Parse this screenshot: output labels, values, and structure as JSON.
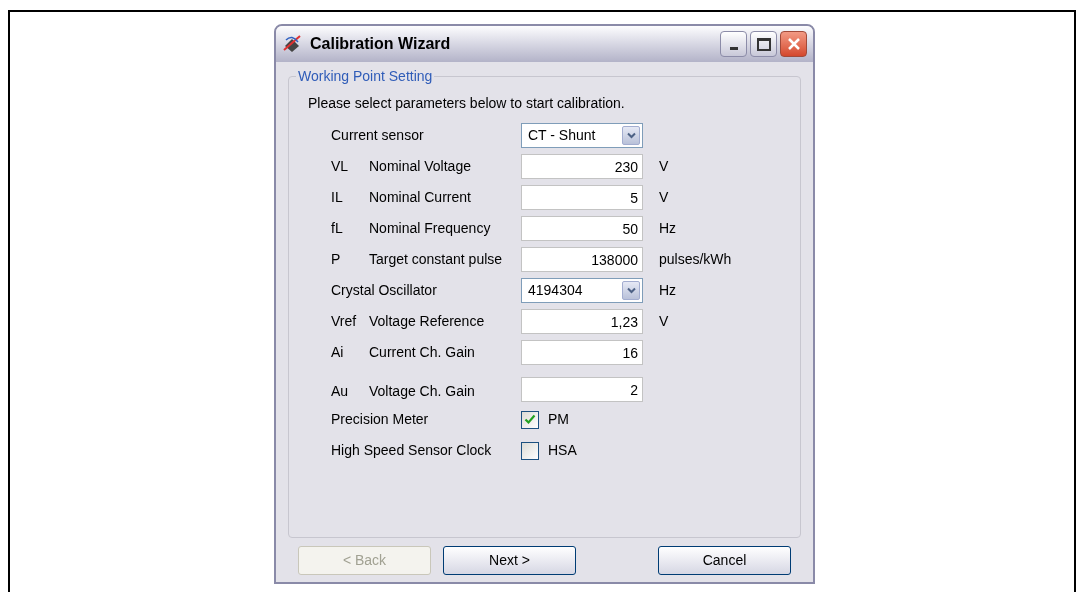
{
  "window": {
    "title": "Calibration Wizard"
  },
  "group": {
    "title": "Working Point Setting",
    "intro": "Please select parameters below to start calibration."
  },
  "rows": [
    {
      "kind": "dropdown",
      "symbol": "",
      "label": "Current sensor",
      "value": "CT - Shunt",
      "unit": ""
    },
    {
      "kind": "text",
      "symbol": "VL",
      "label": "Nominal Voltage",
      "value": "230",
      "unit": "V"
    },
    {
      "kind": "text",
      "symbol": "IL",
      "label": "Nominal Current",
      "value": "5",
      "unit": "V"
    },
    {
      "kind": "text",
      "symbol": "fL",
      "label": "Nominal Frequency",
      "value": "50",
      "unit": "Hz"
    },
    {
      "kind": "text",
      "symbol": "P",
      "label": "Target constant pulse",
      "value": "138000",
      "unit": "pulses/kWh"
    },
    {
      "kind": "dropdown",
      "symbol": "",
      "label": "Crystal Oscillator",
      "value": "4194304",
      "unit": "Hz"
    },
    {
      "kind": "text",
      "symbol": "Vref",
      "label": "Voltage Reference",
      "value": "1,23",
      "unit": "V"
    },
    {
      "kind": "text",
      "symbol": "Ai",
      "label": "Current Ch. Gain",
      "value": "16",
      "unit": ""
    },
    {
      "kind": "text",
      "symbol": "Au",
      "label": "Voltage Ch. Gain",
      "value": "2",
      "unit": ""
    },
    {
      "kind": "checkbox",
      "symbol": "",
      "label": "Precision Meter",
      "value": "PM",
      "checked": true
    },
    {
      "kind": "checkbox",
      "symbol": "",
      "label": "High Speed Sensor Clock",
      "value": "HSA",
      "checked": false
    }
  ],
  "buttons": [
    {
      "label": "< Back",
      "disabled": true
    },
    {
      "label": "Next >",
      "disabled": false
    },
    {
      "label": "Cancel",
      "disabled": false
    }
  ]
}
